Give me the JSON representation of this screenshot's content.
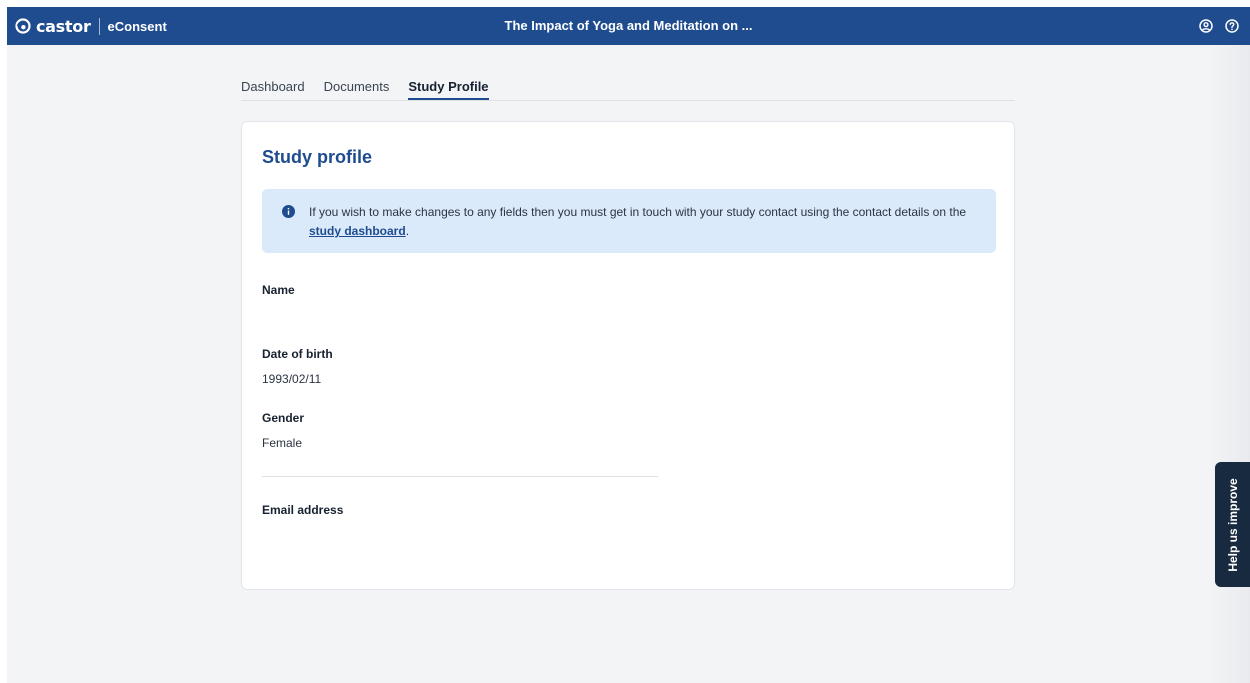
{
  "topbar": {
    "brand_name": "castor",
    "product_name": "eConsent",
    "study_title": "The Impact of Yoga and Meditation on ...",
    "icons": [
      "user-account-icon",
      "help-icon"
    ]
  },
  "tabs": [
    {
      "label": "Dashboard",
      "active": false
    },
    {
      "label": "Documents",
      "active": false
    },
    {
      "label": "Study Profile",
      "active": true
    }
  ],
  "profile": {
    "title": "Study profile",
    "info_text_before": "If you wish to make changes to any fields then you must get in touch with your study contact using the contact details on the",
    "info_link": "study dashboard",
    "info_text_after": ".",
    "fields": {
      "name_label": "Name",
      "name_value": "",
      "dob_label": "Date of birth",
      "dob_value": "1993/02/11",
      "gender_label": "Gender",
      "gender_value": "Female",
      "email_label": "Email address",
      "email_value": ""
    }
  },
  "feedback": {
    "label": "Help us improve"
  },
  "colors": {
    "header_bg": "#1e4c8f",
    "accent": "#1e4c8f",
    "info_bg": "#dbeafa",
    "page_bg": "#f3f4f6",
    "feedback_bg": "#172a3f"
  }
}
